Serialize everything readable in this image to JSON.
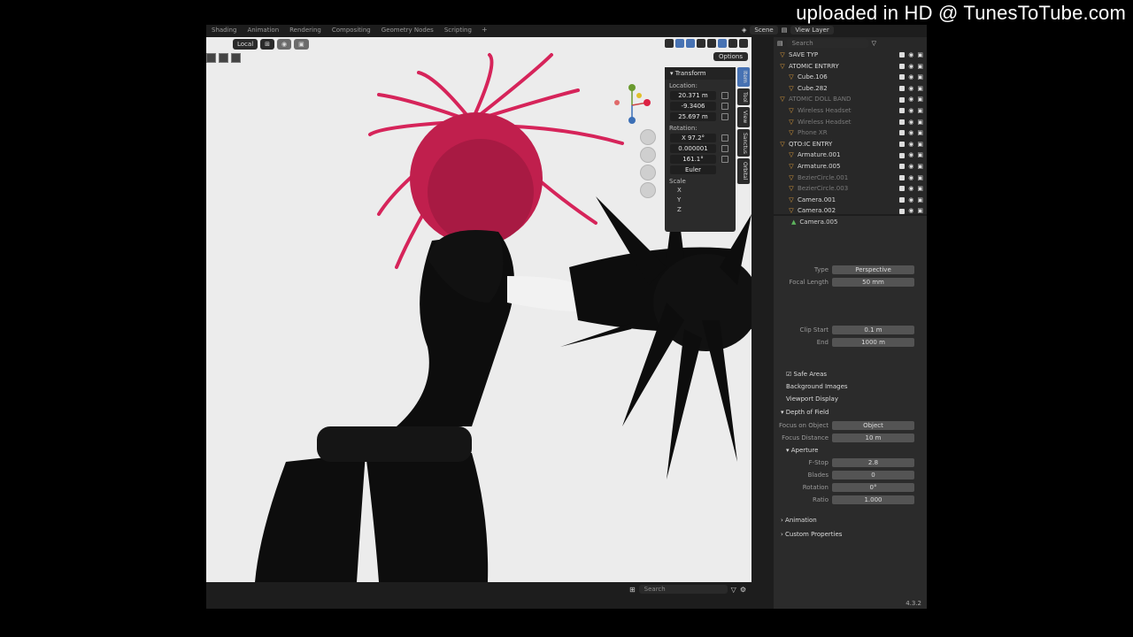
{
  "watermark": "uploaded in HD @ TunesToTube.com",
  "workspace_tabs": [
    "Shading",
    "Animation",
    "Rendering",
    "Compositing",
    "Geometry Nodes",
    "Scripting"
  ],
  "workspace_add": "+",
  "scene": {
    "scene_label": "Scene",
    "viewlayer_label": "View Layer"
  },
  "viewport": {
    "pivot": "Local",
    "options_label": "Options",
    "search_placeholder": "Search"
  },
  "transform_panel": {
    "title": "Transform",
    "location_label": "Location:",
    "location": [
      "20.371 m",
      "-9.3406",
      "25.697 m"
    ],
    "rotation_label": "Rotation:",
    "rotation": [
      "X   97.2°",
      "0.000001",
      "161.1°"
    ],
    "rotation_mode": "Euler",
    "scale_label": "Scale",
    "scale_axes": [
      "X",
      "Y",
      "Z"
    ]
  },
  "n_tabs": [
    "Item",
    "Tool",
    "View",
    "Sanctus",
    "Orbital"
  ],
  "outliner": {
    "search_placeholder": "Search",
    "rows": [
      {
        "name": "SAVE TYP",
        "dim": false
      },
      {
        "name": "ATOMIC ENTRRY",
        "dim": false
      },
      {
        "name": "Cube.106",
        "dim": false
      },
      {
        "name": "Cube.282",
        "dim": false
      },
      {
        "name": "ATOMIC DOLL BAND",
        "dim": true
      },
      {
        "name": "Wireless Headset",
        "dim": true
      },
      {
        "name": "Wireless Headset",
        "dim": true
      },
      {
        "name": "Phone XR",
        "dim": true
      },
      {
        "name": "QTO:IC ENTRY",
        "dim": false
      },
      {
        "name": "Armature.001",
        "dim": false
      },
      {
        "name": "Armature.005",
        "dim": false
      },
      {
        "name": "BezierCircle.001",
        "dim": true
      },
      {
        "name": "BezierCircle.003",
        "dim": true
      },
      {
        "name": "Camera.001",
        "dim": false
      },
      {
        "name": "Camera.002",
        "dim": false
      }
    ]
  },
  "properties": {
    "object_name": "Camera.005",
    "rows": [
      {
        "label": "Type",
        "value": "Perspective"
      },
      {
        "label": "Focal Length",
        "value": "50 mm"
      },
      {
        "label": "Clip Start",
        "value": "0.1 m"
      },
      {
        "label": "End",
        "value": "1000 m"
      }
    ],
    "safe_areas": "Safe Areas",
    "background_images": "Background Images",
    "viewport_display": "Viewport Display",
    "dof_title": "Depth of Field",
    "focus_object_label": "Focus on Object",
    "focus_object_value": "Object",
    "focus_distance_label": "Focus Distance",
    "focus_distance_value": "10 m",
    "aperture_title": "Aperture",
    "aperture_rows": [
      {
        "label": "F-Stop",
        "value": "2.8"
      },
      {
        "label": "Blades",
        "value": "0"
      },
      {
        "label": "Rotation",
        "value": "0°"
      },
      {
        "label": "Ratio",
        "value": "1.000"
      }
    ],
    "animation_label": "Animation",
    "custom_props_label": "Custom Properties"
  },
  "version": "4.3.2",
  "colors": {
    "accent": "#4772b3",
    "hair": "#d6245a",
    "figure": "#0d0d0d"
  }
}
